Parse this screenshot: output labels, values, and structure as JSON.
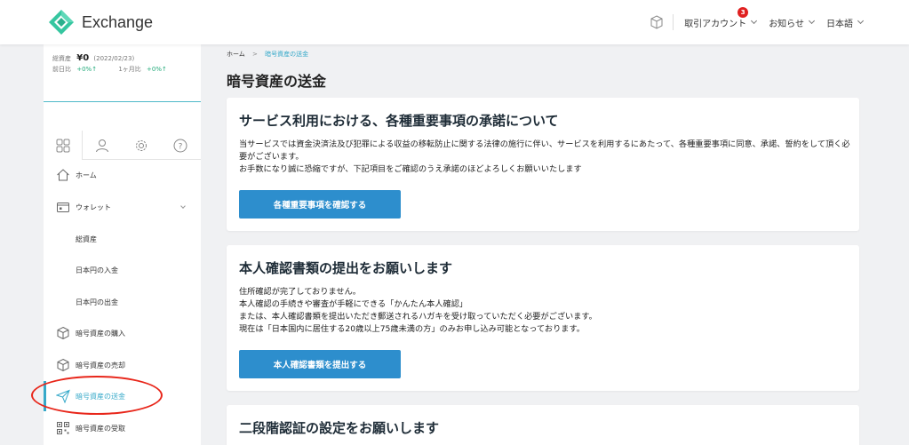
{
  "header": {
    "logo_text": "Exchange",
    "account_label": "取引アカウント",
    "account_badge": "3",
    "notice_label": "お知らせ",
    "language_label": "日本語",
    "brand_color": "#36c6a0"
  },
  "assets": {
    "total_label": "総資産",
    "total_value": "¥0",
    "date": "(2022/02/23)",
    "day_label": "前日比",
    "day_change": "+0%↑",
    "month_label": "1ヶ月比",
    "month_change": "+0%↑"
  },
  "sidebar": {
    "tabs": [
      "dashboard-icon",
      "user-icon",
      "gear-icon",
      "help-icon"
    ],
    "items": [
      {
        "label": "ホーム",
        "icon": "home-icon"
      },
      {
        "label": "ウォレット",
        "icon": "wallet-icon"
      },
      {
        "label": "総資産"
      },
      {
        "label": "日本円の入金"
      },
      {
        "label": "日本円の出金"
      },
      {
        "label": "暗号資産の購入",
        "icon": "cube-icon"
      },
      {
        "label": "暗号資産の売却",
        "icon": "cube-icon"
      },
      {
        "label": "暗号資産の送金",
        "icon": "send-icon",
        "active": true
      },
      {
        "label": "暗号資産の受取",
        "icon": "qr-icon"
      }
    ],
    "accent_color": "#36a9c9"
  },
  "breadcrumb": {
    "home": "ホーム",
    "separator": ">",
    "current": "暗号資産の送金"
  },
  "page_title": "暗号資産の送金",
  "cards": [
    {
      "title": "サービス利用における、各種重要事項の承諾について",
      "lines": [
        "当サービスでは資金決済法及び犯罪による収益の移転防止に関する法律の施行に伴い、サービスを利用するにあたって、各種重要事項に同意、承諾、誓約をして頂く必要がございます。",
        "お手数になり誠に恐縮ですが、下記項目をご確認のうえ承諾のほどよろしくお願いいたします"
      ],
      "button": "各種重要事項を確認する"
    },
    {
      "title": "本人確認書類の提出をお願いします",
      "lines": [
        "住所確認が完了しておりません。",
        "本人確認の手続きや審査が手軽にできる「かんたん本人確認」",
        "または、本人確認書類を提出いただき郵送されるハガキを受け取っていただく必要がございます。",
        "現在は「日本国内に居住する20歳以上75歳未満の方」のみお申し込み可能となっております。"
      ],
      "button": "本人確認書類を提出する"
    },
    {
      "title": "二段階認証の設定をお願いします"
    }
  ]
}
